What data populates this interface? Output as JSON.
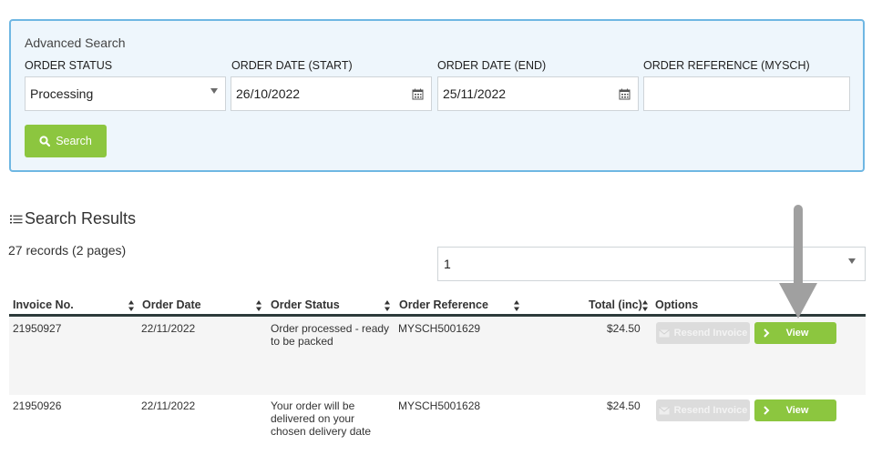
{
  "advanced_search": {
    "title": "Advanced Search",
    "order_status": {
      "label": "ORDER STATUS",
      "value": "Processing"
    },
    "order_date_start": {
      "label": "ORDER DATE (START)",
      "value": "26/10/2022"
    },
    "order_date_end": {
      "label": "ORDER DATE (END)",
      "value": "25/11/2022"
    },
    "order_reference": {
      "label": "ORDER REFERENCE (MYSCH)",
      "value": ""
    },
    "search_button": "Search"
  },
  "results": {
    "title": "Search Results",
    "records_summary": "27 records (2 pages)",
    "page_select_value": "1",
    "columns": [
      "Invoice No.",
      "Order Date",
      "Order Status",
      "Order Reference",
      "Total (inc)",
      "Options"
    ],
    "rows": [
      {
        "invoice_no": "21950927",
        "order_date": "22/11/2022",
        "order_status": "Order processed - ready to be packed",
        "order_reference": "MYSCH5001629",
        "total": "$24.50",
        "resend_label": "Resend Invoice",
        "view_label": "View"
      },
      {
        "invoice_no": "21950926",
        "order_date": "22/11/2022",
        "order_status": "Your order will be delivered on your chosen delivery date",
        "order_reference": "MYSCH5001628",
        "total": "$24.50",
        "resend_label": "Resend Invoice",
        "view_label": "View"
      }
    ]
  },
  "colors": {
    "accent_green": "#8cc63f",
    "panel_border": "#6fb7e3",
    "panel_bg": "#eef6fc",
    "annotation_arrow": "#a0a0a0"
  }
}
